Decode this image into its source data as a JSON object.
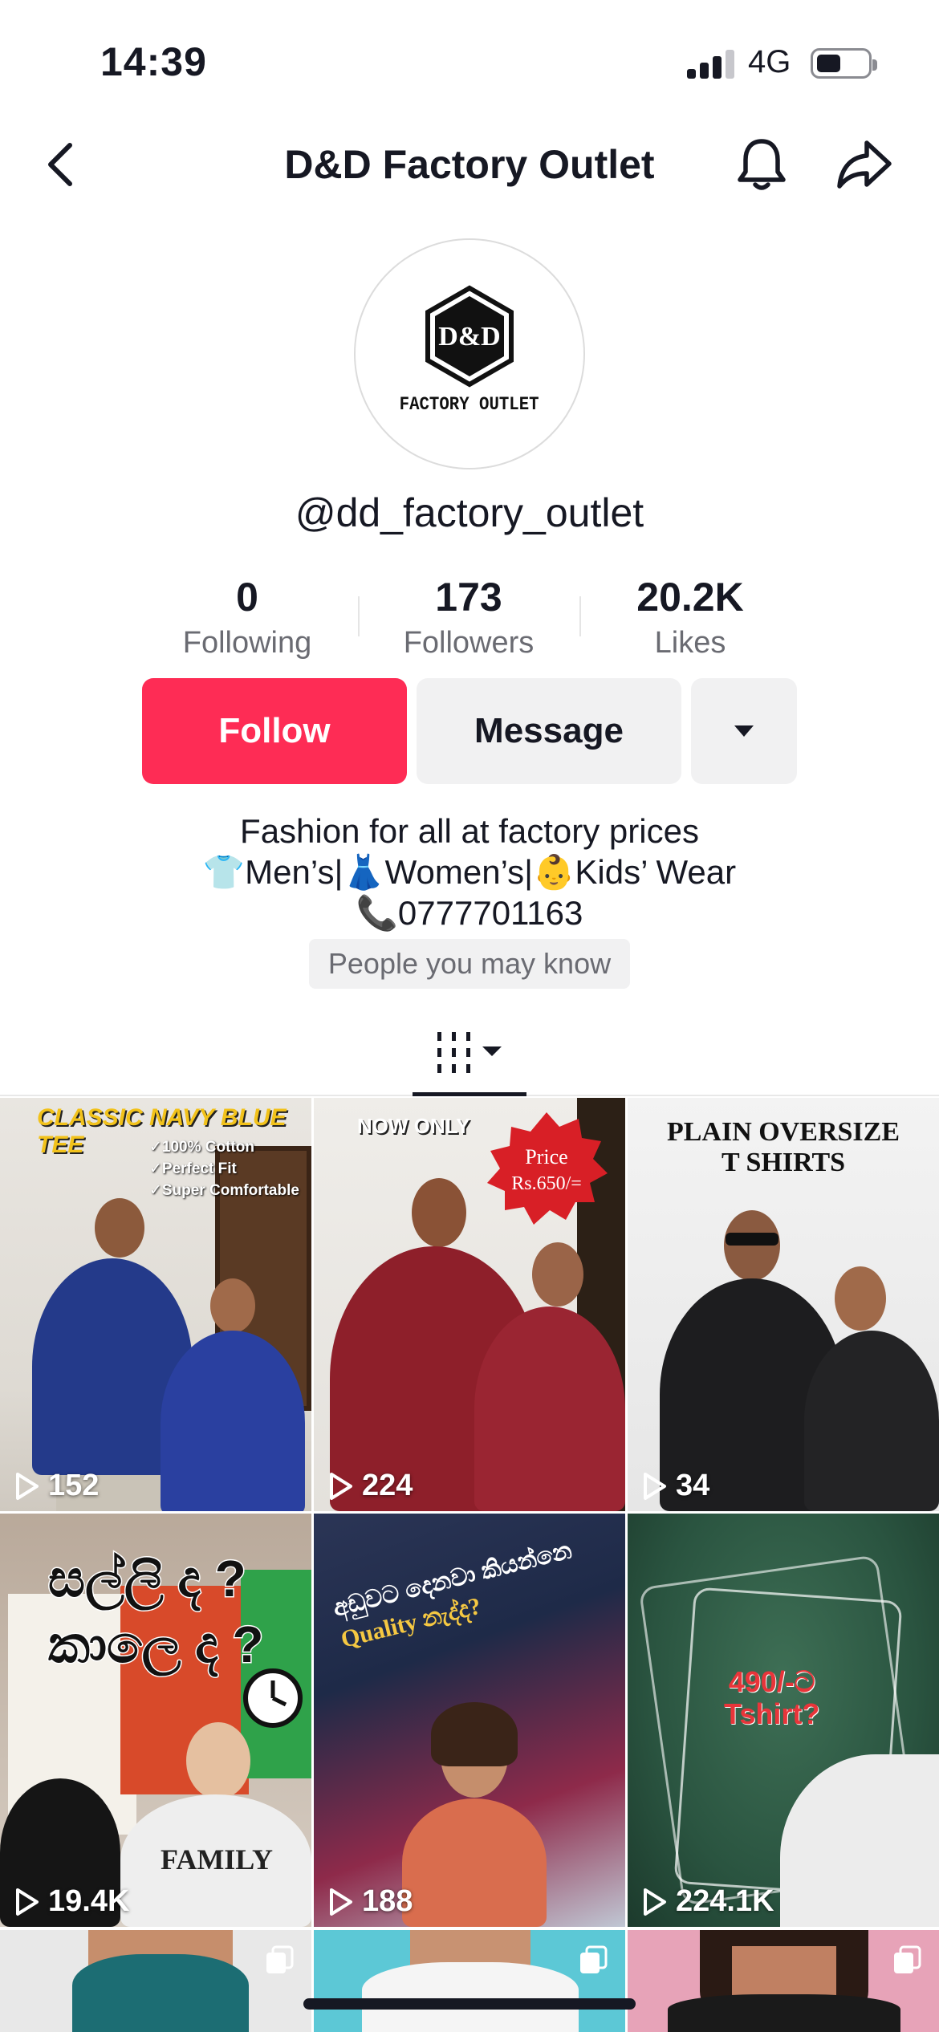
{
  "status_bar": {
    "time": "14:39",
    "network": "4G",
    "battery_level": 0.45
  },
  "nav": {
    "title": "D&D Factory Outlet",
    "back_icon": "chevron-left-icon",
    "bell_icon": "bell-icon",
    "share_icon": "share-icon"
  },
  "profile": {
    "avatar_logo_text": "D&D",
    "avatar_brand_text": "FACTORY OUTLET",
    "username": "@dd_factory_outlet"
  },
  "stats": [
    {
      "value": "0",
      "label": "Following"
    },
    {
      "value": "173",
      "label": "Followers"
    },
    {
      "value": "20.2K",
      "label": "Likes"
    }
  ],
  "actions": {
    "follow": "Follow",
    "message": "Message",
    "more_icon": "caret-down-icon"
  },
  "bio": {
    "line1": "Fashion for all at factory prices",
    "line2": "👕Men’s|👗Women’s|👶Kids’ Wear",
    "line3": "📞0777701163",
    "people_chip": "People you may know"
  },
  "tabs": {
    "videos_icon": "grid-icon"
  },
  "videos": [
    {
      "views": "152",
      "caption": "CLASSIC NAVY BLUE TEE",
      "bullets": [
        "✓100% Cotton",
        "✓Perfect Fit",
        "✓Super Comfortable"
      ]
    },
    {
      "views": "224",
      "caption": "NOW ONLY",
      "badge_line1": "Price",
      "badge_line2": "Rs.650/="
    },
    {
      "views": "34",
      "caption_line1": "PLAIN OVERSIZE",
      "caption_line2": "T SHIRTS"
    },
    {
      "views": "19.4K",
      "caption_line1": "සල්ලි ද ?",
      "caption_line2": "කාලෙ ද ?",
      "shirt_text": "FAMILY"
    },
    {
      "views": "188",
      "caption_line1": "අඩුවට දෙනවා කියන්නෙ",
      "caption_line2": "Quality නැද්ද?"
    },
    {
      "views": "224.1K",
      "caption_line1": "490/-ට",
      "caption_line2": "Tshirt?"
    }
  ],
  "colors": {
    "accent": "#fe2c55",
    "text": "#161823",
    "muted": "#6a6b72",
    "chip_bg": "#f1f1f2"
  }
}
